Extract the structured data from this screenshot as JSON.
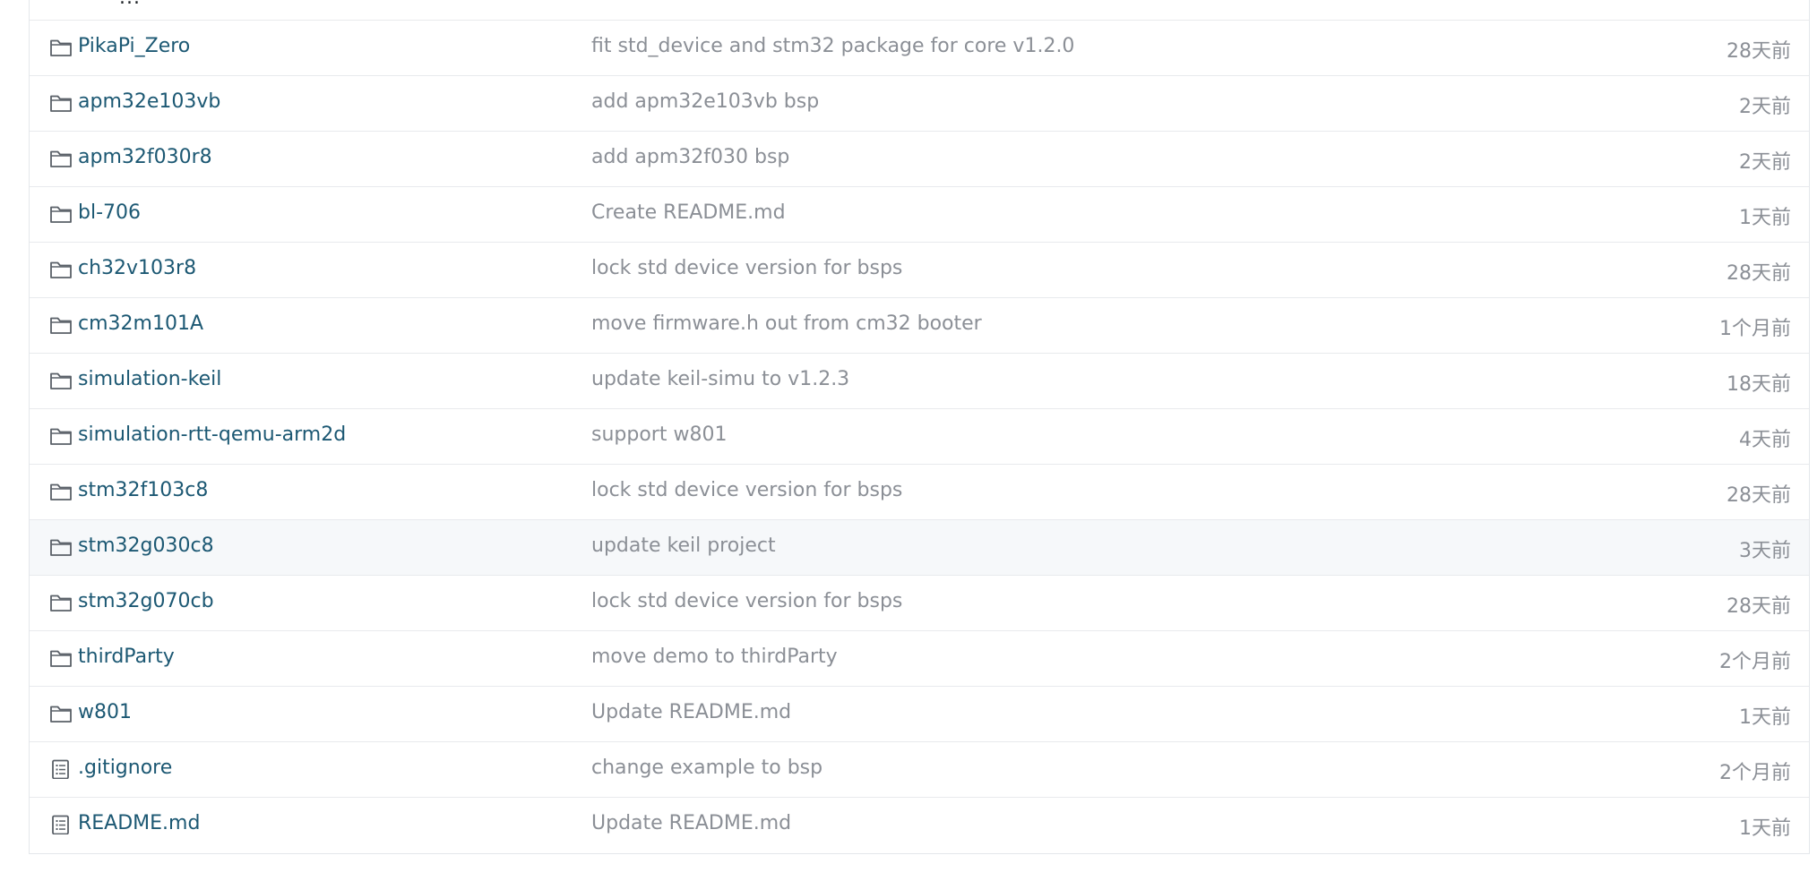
{
  "file_list": {
    "top_partial_text": "...",
    "rows": [
      {
        "type": "folder",
        "icon": "folder-icon",
        "name": "PikaPi_Zero",
        "message": "fit std_device and stm32 package for core v1.2.0",
        "time": "28天前"
      },
      {
        "type": "folder",
        "icon": "folder-icon",
        "name": "apm32e103vb",
        "message": "add apm32e103vb bsp",
        "time": "2天前"
      },
      {
        "type": "folder",
        "icon": "folder-icon",
        "name": "apm32f030r8",
        "message": "add apm32f030 bsp",
        "time": "2天前"
      },
      {
        "type": "folder",
        "icon": "folder-icon",
        "name": "bl-706",
        "message": "Create README.md",
        "time": "1天前"
      },
      {
        "type": "folder",
        "icon": "folder-icon",
        "name": "ch32v103r8",
        "message": "lock std device version for bsps",
        "time": "28天前"
      },
      {
        "type": "folder",
        "icon": "folder-icon",
        "name": "cm32m101A",
        "message": "move firmware.h out from cm32 booter",
        "time": "1个月前"
      },
      {
        "type": "folder",
        "icon": "folder-icon",
        "name": "simulation-keil",
        "message": "update keil-simu to v1.2.3",
        "time": "18天前"
      },
      {
        "type": "folder",
        "icon": "folder-icon",
        "name": "simulation-rtt-qemu-arm2d",
        "message": "support w801",
        "time": "4天前"
      },
      {
        "type": "folder",
        "icon": "folder-icon",
        "name": "stm32f103c8",
        "message": "lock std device version for bsps",
        "time": "28天前"
      },
      {
        "type": "folder",
        "icon": "folder-icon",
        "name": "stm32g030c8",
        "message": "update keil project",
        "time": "3天前",
        "highlight": true
      },
      {
        "type": "folder",
        "icon": "folder-icon",
        "name": "stm32g070cb",
        "message": "lock std device version for bsps",
        "time": "28天前"
      },
      {
        "type": "folder",
        "icon": "folder-icon",
        "name": "thirdParty",
        "message": "move demo to thirdParty",
        "time": "2个月前"
      },
      {
        "type": "folder",
        "icon": "folder-icon",
        "name": "w801",
        "message": "Update README.md",
        "time": "1天前"
      },
      {
        "type": "file",
        "icon": "file-icon",
        "name": ".gitignore",
        "message": "change example to bsp",
        "time": "2个月前"
      },
      {
        "type": "file",
        "icon": "file-icon",
        "name": "README.md",
        "message": "Update README.md",
        "time": "1天前"
      }
    ]
  },
  "colors": {
    "link": "#1c5873",
    "muted": "#8b8f96",
    "border": "#e8eaed",
    "highlight_bg": "#f6f8fa"
  }
}
